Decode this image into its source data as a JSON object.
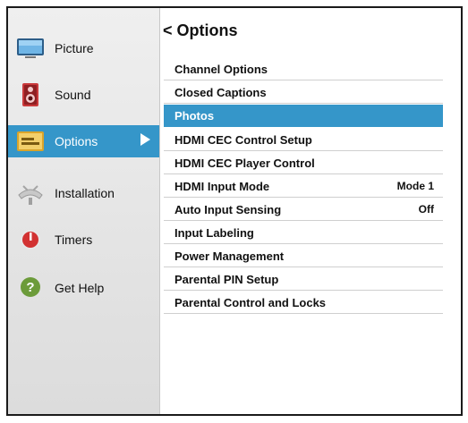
{
  "sidebar": {
    "items": [
      {
        "label": "Picture",
        "icon": "tv-icon"
      },
      {
        "label": "Sound",
        "icon": "speaker-icon"
      },
      {
        "label": "Options",
        "icon": "options-icon",
        "active": true
      },
      {
        "label": "Installation",
        "icon": "satellite-dish-icon"
      },
      {
        "label": "Timers",
        "icon": "timer-icon"
      },
      {
        "label": "Get Help",
        "icon": "help-icon"
      }
    ]
  },
  "header": {
    "back_glyph": "<",
    "title": "Options"
  },
  "menu": {
    "items": [
      {
        "label": "Channel Options",
        "value": ""
      },
      {
        "label": "Closed Captions",
        "value": ""
      },
      {
        "label": "Photos",
        "value": "",
        "active": true
      },
      {
        "label": "HDMI CEC Control Setup",
        "value": ""
      },
      {
        "label": "HDMI CEC Player Control",
        "value": ""
      },
      {
        "label": "HDMI Input Mode",
        "value": "Mode 1"
      },
      {
        "label": "Auto Input Sensing",
        "value": "Off"
      },
      {
        "label": "Input Labeling",
        "value": ""
      },
      {
        "label": "Power Management",
        "value": ""
      },
      {
        "label": "Parental PIN Setup",
        "value": ""
      },
      {
        "label": "Parental Control and Locks",
        "value": ""
      }
    ]
  },
  "colors": {
    "accent": "#3596c9",
    "sidebar_bg": "#e6e6e6",
    "text": "#111111"
  }
}
